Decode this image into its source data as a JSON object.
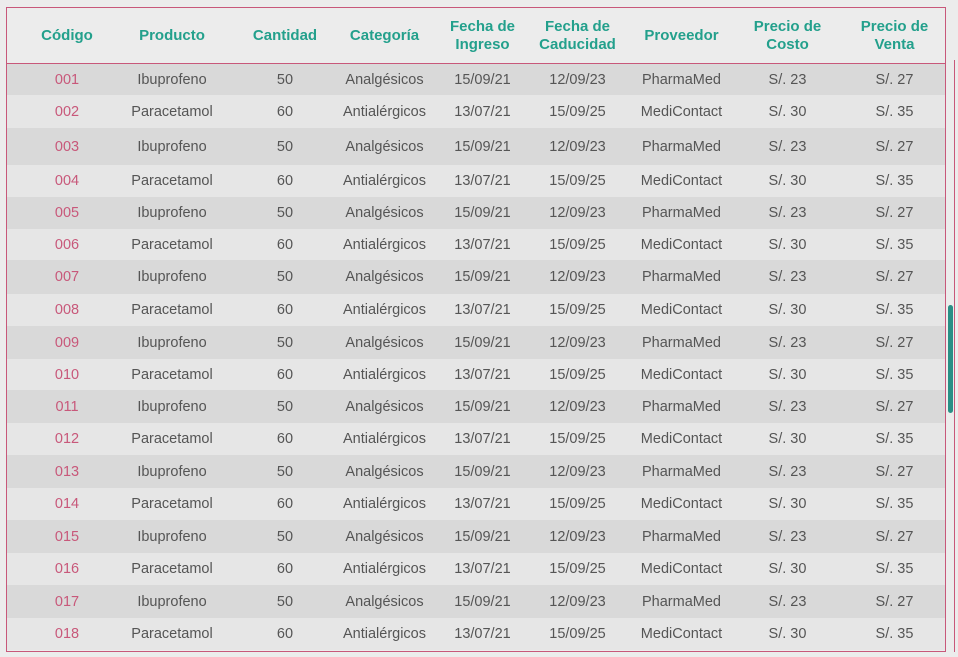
{
  "table": {
    "headers": [
      "Código",
      "Producto",
      "Cantidad",
      "Categoría",
      "Fecha de\nIngreso",
      "Fecha de\nCaducidad",
      "Proveedor",
      "Precio de\nCosto",
      "Precio de\nVenta"
    ],
    "rows": [
      [
        "001",
        "Ibuprofeno",
        "50",
        "Analgésicos",
        "15/09/21",
        "12/09/23",
        "PharmaMed",
        "S/. 23",
        "S/. 27"
      ],
      [
        "002",
        "Paracetamol",
        "60",
        "Antialérgicos",
        "13/07/21",
        "15/09/25",
        "MediContact",
        "S/. 30",
        "S/. 35"
      ],
      [
        "003",
        "Ibuprofeno",
        "50",
        "Analgésicos",
        "15/09/21",
        "12/09/23",
        "PharmaMed",
        "S/. 23",
        "S/. 27"
      ],
      [
        "004",
        "Paracetamol",
        "60",
        "Antialérgicos",
        "13/07/21",
        "15/09/25",
        "MediContact",
        "S/. 30",
        "S/. 35"
      ],
      [
        "005",
        "Ibuprofeno",
        "50",
        "Analgésicos",
        "15/09/21",
        "12/09/23",
        "PharmaMed",
        "S/. 23",
        "S/. 27"
      ],
      [
        "006",
        "Paracetamol",
        "60",
        "Antialérgicos",
        "13/07/21",
        "15/09/25",
        "MediContact",
        "S/. 30",
        "S/. 35"
      ],
      [
        "007",
        "Ibuprofeno",
        "50",
        "Analgésicos",
        "15/09/21",
        "12/09/23",
        "PharmaMed",
        "S/. 23",
        "S/. 27"
      ],
      [
        "008",
        "Paracetamol",
        "60",
        "Antialérgicos",
        "13/07/21",
        "15/09/25",
        "MediContact",
        "S/. 30",
        "S/. 35"
      ],
      [
        "009",
        "Ibuprofeno",
        "50",
        "Analgésicos",
        "15/09/21",
        "12/09/23",
        "PharmaMed",
        "S/. 23",
        "S/. 27"
      ],
      [
        "010",
        "Paracetamol",
        "60",
        "Antialérgicos",
        "13/07/21",
        "15/09/25",
        "MediContact",
        "S/. 30",
        "S/. 35"
      ],
      [
        "011",
        "Ibuprofeno",
        "50",
        "Analgésicos",
        "15/09/21",
        "12/09/23",
        "PharmaMed",
        "S/. 23",
        "S/. 27"
      ],
      [
        "012",
        "Paracetamol",
        "60",
        "Antialérgicos",
        "13/07/21",
        "15/09/25",
        "MediContact",
        "S/. 30",
        "S/. 35"
      ],
      [
        "013",
        "Ibuprofeno",
        "50",
        "Analgésicos",
        "15/09/21",
        "12/09/23",
        "PharmaMed",
        "S/. 23",
        "S/. 27"
      ],
      [
        "014",
        "Paracetamol",
        "60",
        "Antialérgicos",
        "13/07/21",
        "15/09/25",
        "MediContact",
        "S/. 30",
        "S/. 35"
      ],
      [
        "015",
        "Ibuprofeno",
        "50",
        "Analgésicos",
        "15/09/21",
        "12/09/23",
        "PharmaMed",
        "S/. 23",
        "S/. 27"
      ],
      [
        "016",
        "Paracetamol",
        "60",
        "Antialérgicos",
        "13/07/21",
        "15/09/25",
        "MediContact",
        "S/. 30",
        "S/. 35"
      ],
      [
        "017",
        "Ibuprofeno",
        "50",
        "Analgésicos",
        "15/09/21",
        "12/09/23",
        "PharmaMed",
        "S/. 23",
        "S/. 27"
      ],
      [
        "018",
        "Paracetamol",
        "60",
        "Antialérgicos",
        "13/07/21",
        "15/09/25",
        "MediContact",
        "S/. 30",
        "S/. 35"
      ]
    ]
  },
  "colors": {
    "header_text": "#23a08c",
    "code_text": "#c8587a",
    "border": "#c8587a",
    "scrollbar": "#2a8f86"
  }
}
